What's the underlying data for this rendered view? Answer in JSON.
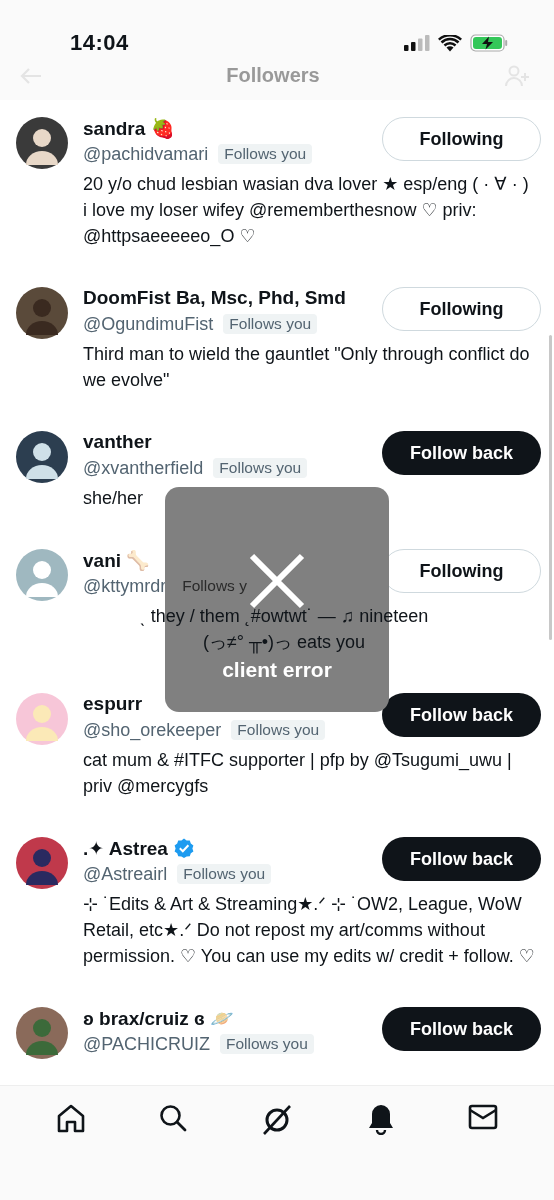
{
  "status_bar": {
    "time": "14:04"
  },
  "header": {
    "title": "Followers"
  },
  "users": [
    {
      "name": "sandra 🍓",
      "verified": false,
      "handle": "@pachidvamari",
      "follows_you": "Follows you",
      "button": {
        "label": "Following",
        "kind": "following"
      },
      "bio": "20 y/o chud lesbian wasian dva lover ★ esp/eng ( · ∀ · ) i love my loser wifey @rememberthesnow ♡ priv: @httpsaeeeeeo_O ♡",
      "centered": false
    },
    {
      "name": "DoomFist Ba, Msc, Phd, Smd",
      "verified": false,
      "handle": "@OgundimuFist",
      "follows_you": "Follows you",
      "button": {
        "label": "Following",
        "kind": "following"
      },
      "bio": "Third man to wield the gauntlet \"Only through conflict do we evolve\"",
      "centered": false
    },
    {
      "name": "vanther",
      "verified": false,
      "handle": "@xvantherfield",
      "follows_you": "Follows you",
      "button": {
        "label": "Follow back",
        "kind": "follow_back"
      },
      "bio": "she/her",
      "centered": false
    },
    {
      "name": "vani 🦴",
      "verified": false,
      "handle": "@kttymrdr",
      "follows_you": "Follows y",
      "button": {
        "label": "Following",
        "kind": "following"
      },
      "bio": "ˎ they / them ˛#owtwt˙ —      ♫      nineteen\n(っ≠° ╥•)っ eats you",
      "centered": true
    },
    {
      "name": "espurr",
      "verified": false,
      "handle": "@sho_orekeeper",
      "follows_you": "Follows you",
      "button": {
        "label": "Follow back",
        "kind": "follow_back"
      },
      "bio": "cat mum & #ITFC supporter | pfp by @Tsugumi_uwu | priv @mercygfs",
      "centered": false
    },
    {
      "name": ".✦ Astrea",
      "verified": true,
      "handle": "@Astreairl",
      "follows_you": "Follows you",
      "button": {
        "label": "Follow back",
        "kind": "follow_back"
      },
      "bio": "⊹ ˙Edits & Art & Streaming★.ᐟ ⊹ ˙OW2, League, WoW Retail, etc★.ᐟ Do not repost my art/comms without permission. ♡ You can use my edits w/ credit + follow. ♡",
      "centered": false
    },
    {
      "name": "ʚ brax/cruiz ɞ 🪐",
      "verified": false,
      "handle": "@PACHICRUIZ",
      "follows_you": "Follows you",
      "button": {
        "label": "Follow back",
        "kind": "follow_back"
      },
      "centered": false
    }
  ],
  "toast": {
    "message": "client error"
  }
}
